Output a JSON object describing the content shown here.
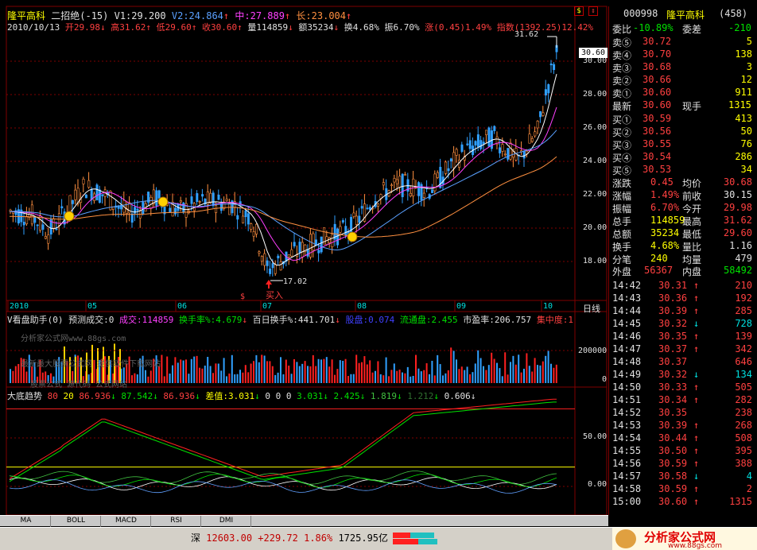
{
  "header": {
    "stock_name": "隆平高科",
    "chart_mode": "二招绝(-15)",
    "v1": "V1:29.200",
    "v2": "V2:24.864",
    "mid": "中:27.889",
    "long": "长:23.004",
    "date": "2010/10/13",
    "open": "开29.98",
    "high": "高31.62",
    "low": "低29.60",
    "close": "收30.60",
    "volume": "量114859",
    "amount": "额35234",
    "turnover": "换4.68%",
    "amplitude": "振6.70%",
    "change": "涨(0.45)1.49%",
    "index": "指数(1392.25)12.42%"
  },
  "price_axis": [
    "30.00",
    "28.00",
    "26.00",
    "24.00",
    "22.00",
    "20.00",
    "18.00"
  ],
  "price_badge": "30.60",
  "price_high_label": "31.62",
  "price_low_label": "17.02",
  "buy_label": "买入",
  "dollar_mark": "$",
  "months": [
    "2010",
    "05",
    "06",
    "07",
    "08",
    "09",
    "10"
  ],
  "period_label": "日线",
  "vol_panel": {
    "title": "V看盘助手(0)",
    "pred": "预测成交:0",
    "deal": "成交:114859",
    "turnover_rate": "换手率%:4.679",
    "hundred_day": "百日换手%:441.701",
    "float_cap": "股盘:0.074",
    "circulating": "流通盘:2.455",
    "pe": "市盈率:206.757",
    "concentration": "集中度:1",
    "axis_top": "200000",
    "axis_zero": "0",
    "watermark1": "分析家公式网www.88gs.com",
    "watermark2": "最新最大股票公式网 提供软件下载网站",
    "watermark3": "股票公式 源代码 公式网站"
  },
  "bottom_panel": {
    "title": "大底趋势",
    "p1": "80",
    "p2": "20",
    "v1": "86.936",
    "v2": "87.542",
    "v3": "86.936",
    "diff": "差值:3.031",
    "v4": "0",
    "v5": "0",
    "v6": "0",
    "v7": "3.031",
    "v8": "2.425",
    "v9": "1.819",
    "v10": "1.212",
    "v11": "0.606",
    "axis_50": "50.00",
    "axis_0": "0.00"
  },
  "tabs": [
    "MA",
    "BOLL",
    "MACD",
    "RSI",
    "DMI"
  ],
  "status": {
    "market": "深",
    "index_val": "12603.00",
    "index_chg": "+229.72",
    "index_pct": "1.86%",
    "index_amount": "1725.95亿",
    "brand": "分析家公式网",
    "brand_url": "www.88gs.com"
  },
  "quote": {
    "code": "000998",
    "name": "隆平高科",
    "count": "(458)",
    "weibi_label": "委比",
    "weibi_val": "-10.89%",
    "weicha_label": "委差",
    "weicha_val": "-210",
    "asks": [
      {
        "label": "卖⑤",
        "price": "30.72",
        "vol": "5"
      },
      {
        "label": "卖④",
        "price": "30.70",
        "vol": "138"
      },
      {
        "label": "卖③",
        "price": "30.68",
        "vol": "3"
      },
      {
        "label": "卖②",
        "price": "30.66",
        "vol": "12"
      },
      {
        "label": "卖①",
        "price": "30.60",
        "vol": "911"
      }
    ],
    "last_label": "最新",
    "last_val": "30.60",
    "hand_label": "现手",
    "hand_val": "1315",
    "bids": [
      {
        "label": "买①",
        "price": "30.59",
        "vol": "413"
      },
      {
        "label": "买②",
        "price": "30.56",
        "vol": "50"
      },
      {
        "label": "买③",
        "price": "30.55",
        "vol": "76"
      },
      {
        "label": "买④",
        "price": "30.54",
        "vol": "286"
      },
      {
        "label": "买⑤",
        "price": "30.53",
        "vol": "34"
      }
    ],
    "stats": [
      {
        "l1": "涨跌",
        "v1": "0.45",
        "l2": "均价",
        "v2": "30.68"
      },
      {
        "l1": "涨幅",
        "v1": "1.49%",
        "l2": "前收",
        "v2": "30.15"
      },
      {
        "l1": "振幅",
        "v1": "6.70%",
        "l2": "今开",
        "v2": "29.98"
      },
      {
        "l1": "总手",
        "v1": "114859",
        "l2": "最高",
        "v2": "31.62"
      },
      {
        "l1": "总额",
        "v1": "35234",
        "l2": "最低",
        "v2": "29.60"
      },
      {
        "l1": "换手",
        "v1": "4.68%",
        "l2": "量比",
        "v2": "1.16"
      },
      {
        "l1": "分笔",
        "v1": "240",
        "l2": "均量",
        "v2": "479"
      }
    ],
    "outer_label": "外盘",
    "outer_val": "56367",
    "inner_label": "内盘",
    "inner_val": "58492",
    "ticks": [
      {
        "t": "14:42",
        "p": "30.31",
        "d": "↑",
        "v": "210"
      },
      {
        "t": "14:43",
        "p": "30.36",
        "d": "↑",
        "v": "192"
      },
      {
        "t": "14:44",
        "p": "30.39",
        "d": "↑",
        "v": "285"
      },
      {
        "t": "14:45",
        "p": "30.32",
        "d": "↓",
        "v": "728"
      },
      {
        "t": "14:46",
        "p": "30.35",
        "d": "↑",
        "v": "139"
      },
      {
        "t": "14:47",
        "p": "30.37",
        "d": "↑",
        "v": "342"
      },
      {
        "t": "14:48",
        "p": "30.37",
        "d": "",
        "v": "646"
      },
      {
        "t": "14:49",
        "p": "30.32",
        "d": "↓",
        "v": "134"
      },
      {
        "t": "14:50",
        "p": "30.33",
        "d": "↑",
        "v": "505"
      },
      {
        "t": "14:51",
        "p": "30.34",
        "d": "↑",
        "v": "282"
      },
      {
        "t": "14:52",
        "p": "30.35",
        "d": "",
        "v": "238"
      },
      {
        "t": "14:53",
        "p": "30.39",
        "d": "↑",
        "v": "268"
      },
      {
        "t": "14:54",
        "p": "30.44",
        "d": "↑",
        "v": "508"
      },
      {
        "t": "14:55",
        "p": "30.50",
        "d": "↑",
        "v": "395"
      },
      {
        "t": "14:56",
        "p": "30.59",
        "d": "↑",
        "v": "388"
      },
      {
        "t": "14:57",
        "p": "30.58",
        "d": "↓",
        "v": "4"
      },
      {
        "t": "14:58",
        "p": "30.59",
        "d": "↑",
        "v": "2"
      },
      {
        "t": "15:00",
        "p": "30.60",
        "d": "↑",
        "v": "1315"
      }
    ]
  },
  "colors": {
    "up": "#ff3030",
    "down": "#00e0e0",
    "bg": "#000000",
    "grid": "#800000",
    "ma_white": "#ffffff",
    "ma_mag": "#ff40ff",
    "ma_blue": "#5aa0ff",
    "ma_orange": "#ff9040"
  }
}
